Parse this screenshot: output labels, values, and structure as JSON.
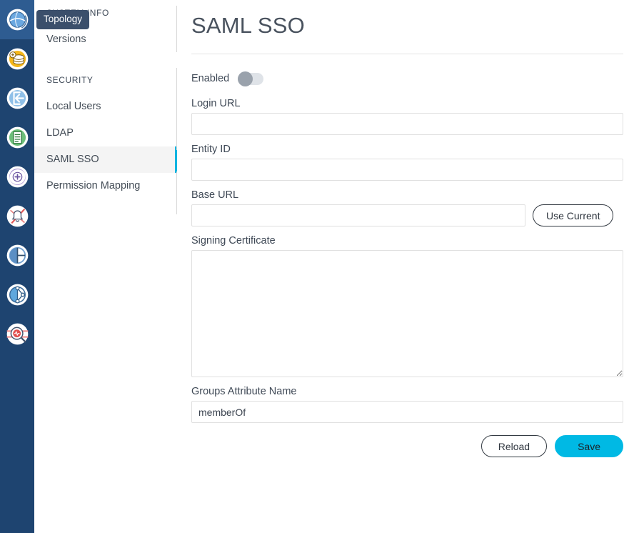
{
  "rail": {
    "items": [
      {
        "icon": "globe-topology-icon",
        "name": "topology",
        "active": true
      },
      {
        "icon": "coins-stack-icon",
        "name": "inventory",
        "active": false
      },
      {
        "icon": "login-arrow-icon",
        "name": "access",
        "active": false
      },
      {
        "icon": "document-list-icon",
        "name": "reports",
        "active": false
      },
      {
        "icon": "add-circle-swirl-icon",
        "name": "provisioning",
        "active": false
      },
      {
        "icon": "bell-alert-icon",
        "name": "alerts",
        "active": false
      },
      {
        "icon": "half-circle-chart-icon",
        "name": "analytics",
        "active": false
      },
      {
        "icon": "graph-nodes-icon",
        "name": "graph",
        "active": false
      },
      {
        "icon": "magnifier-pulse-icon",
        "name": "diagnostics",
        "active": false
      }
    ]
  },
  "tooltip": {
    "text": "Topology"
  },
  "sidebar": {
    "sections": [
      {
        "title": "SYSTEM INFO",
        "items": [
          {
            "label": "Versions",
            "selected": false
          }
        ]
      },
      {
        "title": "SECURITY",
        "items": [
          {
            "label": "Local Users",
            "selected": false
          },
          {
            "label": "LDAP",
            "selected": false
          },
          {
            "label": "SAML SSO",
            "selected": true
          },
          {
            "label": "Permission Mapping",
            "selected": false
          }
        ]
      }
    ]
  },
  "page": {
    "title": "SAML SSO",
    "enabled_label": "Enabled",
    "enabled_value": false
  },
  "fields": {
    "login_url": {
      "label": "Login URL",
      "value": "",
      "placeholder": ""
    },
    "entity_id": {
      "label": "Entity ID",
      "value": "",
      "placeholder": ""
    },
    "base_url": {
      "label": "Base URL",
      "value": "",
      "placeholder": ""
    },
    "use_current_label": "Use Current",
    "signing_certificate": {
      "label": "Signing Certificate",
      "value": "",
      "placeholder": ""
    },
    "groups_attribute": {
      "label": "Groups Attribute Name",
      "value": "memberOf",
      "placeholder": ""
    }
  },
  "actions": {
    "reload_label": "Reload",
    "save_label": "Save"
  },
  "colors": {
    "rail_bg": "#1e4470",
    "rail_active": "#2e5c91",
    "accent": "#00b9e4",
    "selected_row_bg": "#f4f4f4",
    "tooltip_bg": "#3b4f6b"
  }
}
